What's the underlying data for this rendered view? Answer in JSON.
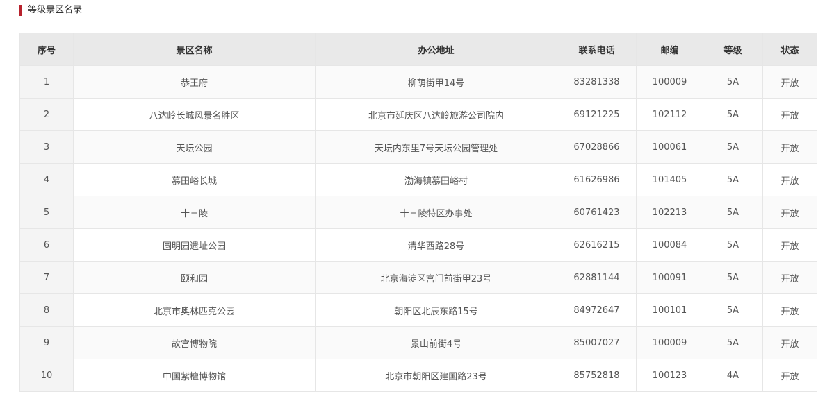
{
  "section": {
    "title": "等级景区名录",
    "accent_color": "#b8222d"
  },
  "table": {
    "headers": [
      "序号",
      "景区名称",
      "办公地址",
      "联系电话",
      "邮编",
      "等级",
      "状态"
    ],
    "rows": [
      [
        "1",
        "恭王府",
        "柳荫街甲14号",
        "83281338",
        "100009",
        "5A",
        "开放"
      ],
      [
        "2",
        "八达岭长城风景名胜区",
        "北京市延庆区八达岭旅游公司院内",
        "69121225",
        "102112",
        "5A",
        "开放"
      ],
      [
        "3",
        "天坛公园",
        "天坛内东里7号天坛公园管理处",
        "67028866",
        "100061",
        "5A",
        "开放"
      ],
      [
        "4",
        "慕田峪长城",
        "渤海镇慕田峪村",
        "61626986",
        "101405",
        "5A",
        "开放"
      ],
      [
        "5",
        "十三陵",
        "十三陵特区办事处",
        "60761423",
        "102213",
        "5A",
        "开放"
      ],
      [
        "6",
        "圆明园遗址公园",
        "清华西路28号",
        "62616215",
        "100084",
        "5A",
        "开放"
      ],
      [
        "7",
        "颐和园",
        "北京海淀区宫门前街甲23号",
        "62881144",
        "100091",
        "5A",
        "开放"
      ],
      [
        "8",
        "北京市奥林匹克公园",
        "朝阳区北辰东路15号",
        "84972647",
        "100101",
        "5A",
        "开放"
      ],
      [
        "9",
        "故宫博物院",
        "景山前街4号",
        "85007027",
        "100009",
        "5A",
        "开放"
      ],
      [
        "10",
        "中国紫檀博物馆",
        "北京市朝阳区建国路23号",
        "85752818",
        "100123",
        "4A",
        "开放"
      ]
    ]
  }
}
